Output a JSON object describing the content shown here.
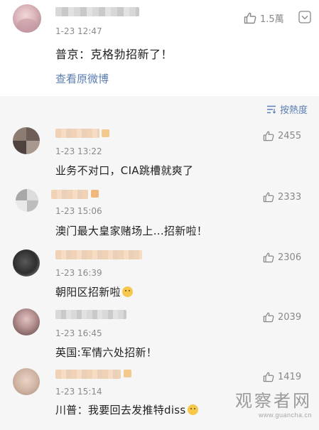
{
  "post": {
    "time": "1-23 12:47",
    "likes": "1.5萬",
    "text": "普京：克格勃招新了！",
    "link": "查看原微博"
  },
  "sort": {
    "label": "按熱度",
    "icon": "sort-icon"
  },
  "comments": [
    {
      "time": "1-23 13:22",
      "likes": "2455",
      "text": "业务不对口，CIA跳槽就爽了"
    },
    {
      "time": "1-23 15:06",
      "likes": "2333",
      "text": "澳门最大皇家赌场上...招新啦！"
    },
    {
      "time": "1-23 16:39",
      "likes": "2306",
      "text": "朝阳区招新啦"
    },
    {
      "time": "1-23 16:45",
      "likes": "2039",
      "text": "英国:军情六处招新！"
    },
    {
      "time": "1-23 15:14",
      "likes": "1419",
      "text": "川普：我要回去发推特diss"
    }
  ],
  "watermark": {
    "logo": "观察者网",
    "url": "www.guancha.cn"
  },
  "colors": {
    "link": "#5b7db3",
    "background": "#f6f6f6",
    "text": "#222222"
  }
}
